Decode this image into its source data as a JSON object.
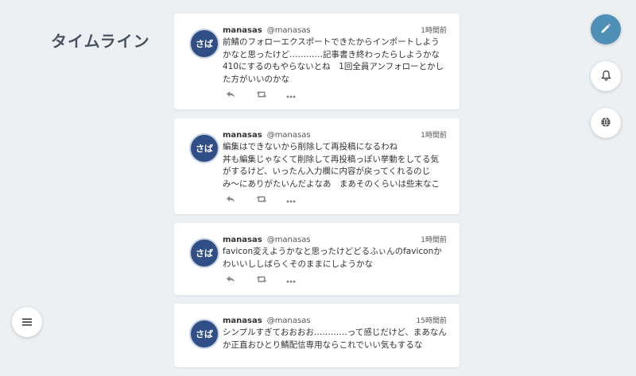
{
  "header": {
    "title": "タイムライン"
  },
  "avatar_text": "さば",
  "posts": [
    {
      "name": "manasas",
      "handle": "@manasas",
      "time": "1時間前",
      "text": "前鯖のフォローエクスポートできたからインポートしようかなと思ったけど…………記事書き終わったらしようかな　410にするのもやらないとね　1回全員アンフォローとかした方がいいのかな"
    },
    {
      "name": "manasas",
      "handle": "@manasas",
      "time": "1時間前",
      "text": "編集はできないから削除して再投稿になるわね\n丼も編集じゃなくて削除して再投稿っぽい挙動をしてる気がするけど、いったん入力欄に内容が戻ってくれるのじみ〜にありがたいんだよなあ　まあそのくらいは些末なことだから良いか"
    },
    {
      "name": "manasas",
      "handle": "@manasas",
      "time": "1時間前",
      "text": "favicon変えようかなと思ったけどどるふぃんのfaviconかわいいししばらくそのままにしようかな"
    },
    {
      "name": "manasas",
      "handle": "@manasas",
      "time": "15時間前",
      "text": "シンプルすぎておおおお…………って感じだけど、まあなんか正直おひとり鯖配信専用ならこれでいい気もするな"
    }
  ],
  "icons": {
    "reply": "reply-icon",
    "boost": "boost-icon",
    "more": "more-icon",
    "compose": "pencil-icon",
    "notifications": "bell-icon",
    "federated": "globe-icon",
    "menu": "menu-icon"
  },
  "colors": {
    "accent": "#4e8fb8",
    "background": "#edf0f3"
  }
}
